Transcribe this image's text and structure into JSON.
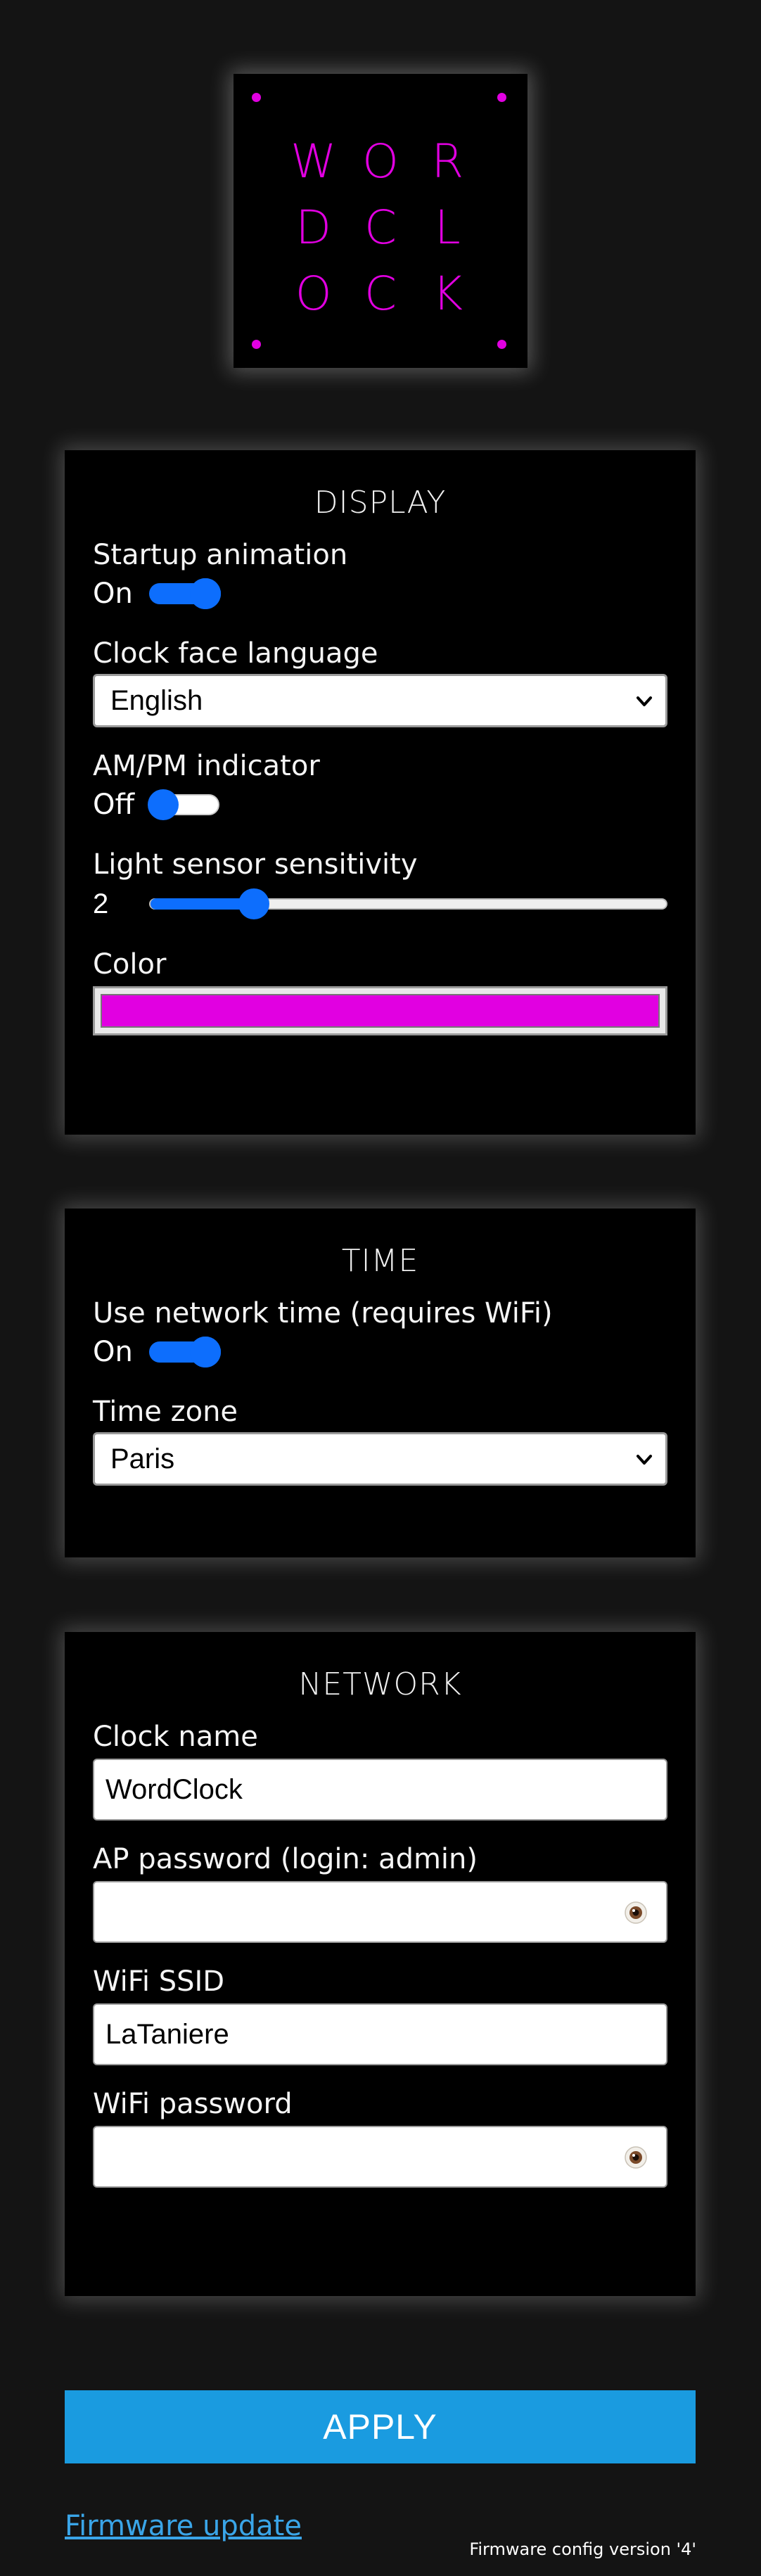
{
  "logo": {
    "letters": [
      "W",
      "O",
      "R",
      "D",
      "C",
      "L",
      "O",
      "C",
      "K"
    ],
    "color": "#e100e1"
  },
  "display": {
    "title": "DISPLAY",
    "startup_animation": {
      "label": "Startup animation",
      "state": "On"
    },
    "language": {
      "label": "Clock face language",
      "value": "English"
    },
    "ampm": {
      "label": "AM/PM indicator",
      "state": "Off"
    },
    "light_sensor": {
      "label": "Light sensor sensitivity",
      "value": "2",
      "fraction": 0.2
    },
    "color": {
      "label": "Color",
      "value": "#e100e1"
    }
  },
  "time": {
    "title": "TIME",
    "network_time": {
      "label": "Use network time (requires WiFi)",
      "state": "On"
    },
    "timezone": {
      "label": "Time zone",
      "value": "Paris"
    }
  },
  "network": {
    "title": "NETWORK",
    "clock_name": {
      "label": "Clock name",
      "value": "WordClock"
    },
    "ap_password": {
      "label": "AP password (login: admin)",
      "value": ""
    },
    "wifi_ssid": {
      "label": "WiFi SSID",
      "value": "LaTaniere"
    },
    "wifi_password": {
      "label": "WiFi password",
      "value": ""
    }
  },
  "footer": {
    "apply_label": "APPLY",
    "firmware_update_label": "Firmware update",
    "firmware_version": "Firmware config version '4'"
  },
  "colors": {
    "accent": "#0d6efd",
    "apply": "#1a9be0",
    "link": "#3aa5e8",
    "background": "#141414"
  }
}
